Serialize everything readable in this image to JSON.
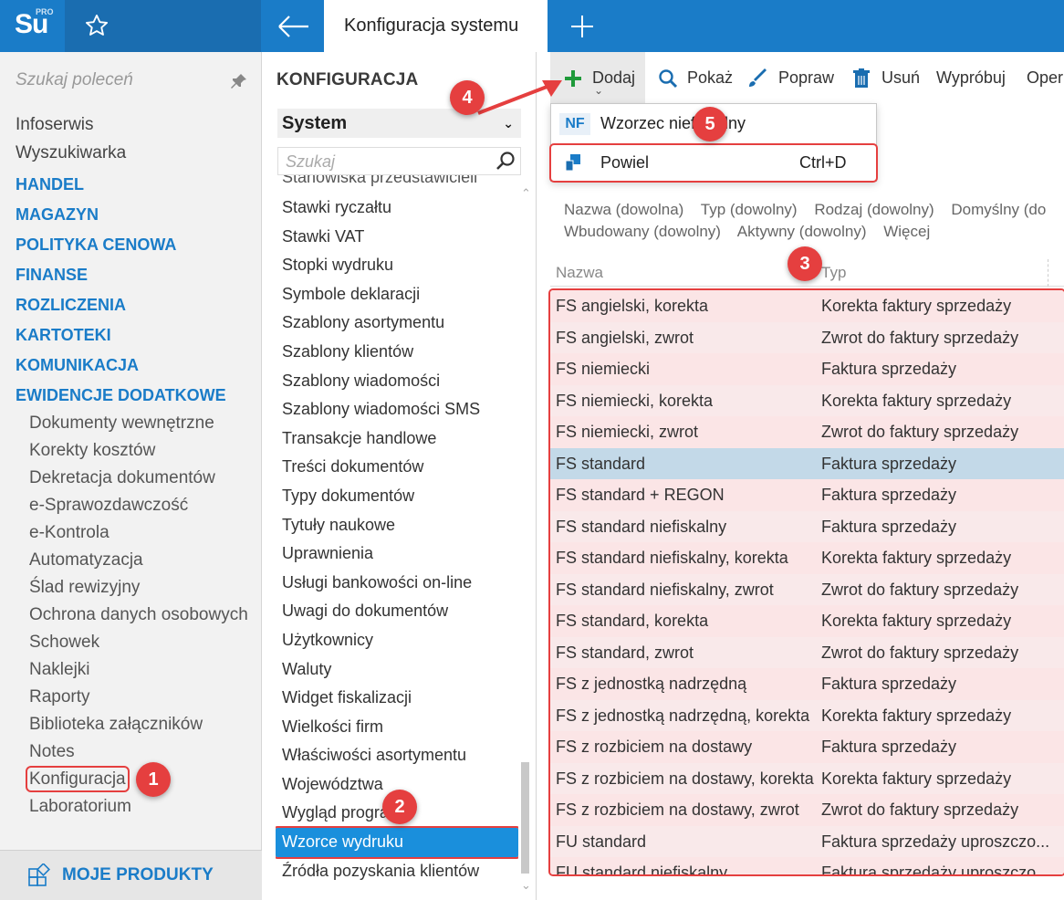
{
  "app": {
    "logo_text": "Su",
    "logo_badge": "PRO",
    "tab_title": "Konfiguracja systemu"
  },
  "sidebar": {
    "search_placeholder": "Szukaj poleceń",
    "items": [
      {
        "label": "Infoserwis",
        "kind": "plain"
      },
      {
        "label": "Wyszukiwarka",
        "kind": "plain"
      },
      {
        "label": "HANDEL",
        "kind": "section"
      },
      {
        "label": "MAGAZYN",
        "kind": "section"
      },
      {
        "label": "POLITYKA CENOWA",
        "kind": "section"
      },
      {
        "label": "FINANSE",
        "kind": "section"
      },
      {
        "label": "ROZLICZENIA",
        "kind": "section"
      },
      {
        "label": "KARTOTEKI",
        "kind": "section"
      },
      {
        "label": "KOMUNIKACJA",
        "kind": "section"
      },
      {
        "label": "EWIDENCJE DODATKOWE",
        "kind": "section"
      },
      {
        "label": "Dokumenty wewnętrzne",
        "kind": "sub"
      },
      {
        "label": "Korekty kosztów",
        "kind": "sub"
      },
      {
        "label": "Dekretacja dokumentów",
        "kind": "sub"
      },
      {
        "label": "e-Sprawozdawczość",
        "kind": "sub"
      },
      {
        "label": "e-Kontrola",
        "kind": "sub"
      },
      {
        "label": "Automatyzacja",
        "kind": "sub"
      },
      {
        "label": "Ślad rewizyjny",
        "kind": "sub"
      },
      {
        "label": "Ochrona danych osobowych",
        "kind": "sub"
      },
      {
        "label": "Schowek",
        "kind": "sub"
      },
      {
        "label": "Naklejki",
        "kind": "sub"
      },
      {
        "label": "Raporty",
        "kind": "sub"
      },
      {
        "label": "Biblioteka załączników",
        "kind": "sub"
      },
      {
        "label": "Notes",
        "kind": "sub"
      },
      {
        "label": "Konfiguracja",
        "kind": "sub",
        "active": true
      },
      {
        "label": "Laboratorium",
        "kind": "sub"
      }
    ],
    "footer": "MOJE PRODUKTY"
  },
  "middle": {
    "title": "KONFIGURACJA",
    "select_value": "System",
    "search_placeholder": "Szukaj",
    "items": [
      "Stanowiska przedstawicieli",
      "Stawki ryczałtu",
      "Stawki VAT",
      "Stopki wydruku",
      "Symbole deklaracji",
      "Szablony asortymentu",
      "Szablony klientów",
      "Szablony wiadomości",
      "Szablony wiadomości SMS",
      "Transakcje handlowe",
      "Treści dokumentów",
      "Typy dokumentów",
      "Tytuły naukowe",
      "Uprawnienia",
      "Usługi bankowości on-line",
      "Uwagi do dokumentów",
      "Użytkownicy",
      "Waluty",
      "Widget fiskalizacji",
      "Wielkości firm",
      "Właściwości asortymentu",
      "Województwa",
      "Wygląd programu",
      "Wzorce wydruku",
      "Źródła pozyskania klientów"
    ],
    "selected": "Wzorce wydruku"
  },
  "toolbar": {
    "add": "Dodaj",
    "show": "Pokaż",
    "edit": "Popraw",
    "delete": "Usuń",
    "try": "Wypróbuj",
    "more": "Oper"
  },
  "dropdown": {
    "item1_badge": "NF",
    "item1_label": "Wzorzec niefiskalny",
    "item2_label": "Powiel",
    "item2_shortcut": "Ctrl+D"
  },
  "filters": {
    "line1": [
      "Nazwa (dowolna)",
      "Typ (dowolny)",
      "Rodzaj (dowolny)",
      "Domyślny (do"
    ],
    "line2": [
      "Wbudowany (dowolny)",
      "Aktywny (dowolny)",
      "Więcej"
    ]
  },
  "grid": {
    "headers": {
      "name": "Nazwa",
      "type": "Typ"
    },
    "rows": [
      {
        "name": "FS angielski, korekta",
        "type": "Korekta faktury sprzedaży"
      },
      {
        "name": "FS angielski, zwrot",
        "type": "Zwrot do faktury sprzedaży"
      },
      {
        "name": "FS niemiecki",
        "type": "Faktura sprzedaży"
      },
      {
        "name": "FS niemiecki, korekta",
        "type": "Korekta faktury sprzedaży"
      },
      {
        "name": "FS niemiecki, zwrot",
        "type": "Zwrot do faktury sprzedaży"
      },
      {
        "name": "FS standard",
        "type": "Faktura sprzedaży",
        "selected": true
      },
      {
        "name": "FS standard + REGON",
        "type": "Faktura sprzedaży"
      },
      {
        "name": "FS standard niefiskalny",
        "type": "Faktura sprzedaży"
      },
      {
        "name": "FS standard niefiskalny, korekta",
        "type": "Korekta faktury sprzedaży"
      },
      {
        "name": "FS standard niefiskalny, zwrot",
        "type": "Zwrot do faktury sprzedaży"
      },
      {
        "name": "FS standard, korekta",
        "type": "Korekta faktury sprzedaży"
      },
      {
        "name": "FS standard, zwrot",
        "type": "Zwrot do faktury sprzedaży"
      },
      {
        "name": "FS z jednostką nadrzędną",
        "type": "Faktura sprzedaży"
      },
      {
        "name": "FS z jednostką nadrzędną, korekta",
        "type": "Korekta faktury sprzedaży"
      },
      {
        "name": "FS z rozbiciem na dostawy",
        "type": "Faktura sprzedaży"
      },
      {
        "name": "FS z rozbiciem na dostawy, korekta",
        "type": "Korekta faktury sprzedaży"
      },
      {
        "name": "FS z rozbiciem na dostawy, zwrot",
        "type": "Zwrot do faktury sprzedaży"
      },
      {
        "name": "FU standard",
        "type": "Faktura sprzedaży uproszczo..."
      },
      {
        "name": "FU standard niefiskalny",
        "type": "Faktura sprzedaży uproszczo..."
      }
    ]
  },
  "annotations": [
    "1",
    "2",
    "3",
    "4",
    "5"
  ],
  "colors": {
    "brand": "#1a7cc8",
    "highlight": "#e53f3f",
    "selected_row": "#c3d9e8"
  }
}
